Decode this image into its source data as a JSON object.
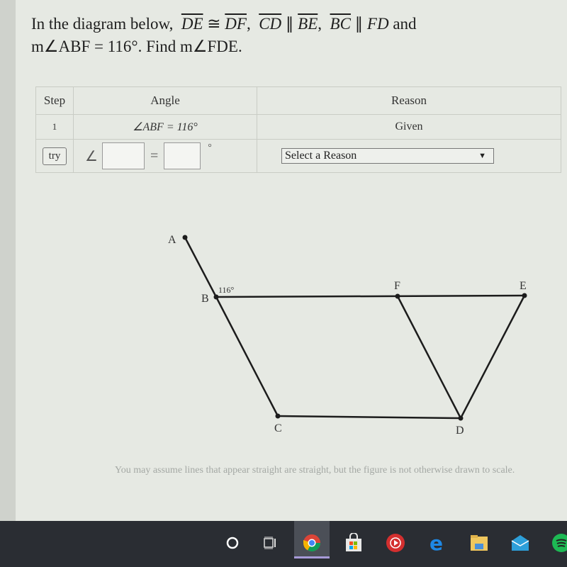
{
  "problem": {
    "intro": "In the diagram below,",
    "seg1": "DE",
    "congruent": "≅",
    "seg2": "DF",
    "seg3": "CD",
    "parallel": "∥",
    "seg4": "BE",
    "seg5": "BC",
    "seg6": "FD",
    "and": "and",
    "line2_given": "m∠ABF = 116°.",
    "line2_find": "Find m∠FDE."
  },
  "table": {
    "headers": {
      "step": "Step",
      "angle": "Angle",
      "reason": "Reason"
    },
    "rows": [
      {
        "step": "1",
        "angle": "∠ABF = 116°",
        "reason": "Given"
      }
    ],
    "input_row": {
      "try_label": "try",
      "angle_symbol": "∠",
      "angle_value": "",
      "equals": "=",
      "degree_value": "",
      "degree_symbol": "°",
      "reason_select": "Select a Reason",
      "dropdown_arrow": "▼"
    }
  },
  "diagram": {
    "points": {
      "A": "A",
      "B": "B",
      "C": "C",
      "D": "D",
      "E": "E",
      "F": "F"
    },
    "angle_label": "116°"
  },
  "note": "You may assume lines that appear straight are straight, but the figure is not otherwise drawn to scale.",
  "taskbar": {
    "icons": [
      "cortana-icon",
      "task-view-icon",
      "chrome-icon",
      "store-icon",
      "music-icon",
      "edge-icon",
      "file-explorer-icon",
      "mail-icon",
      "spotify-icon"
    ]
  }
}
